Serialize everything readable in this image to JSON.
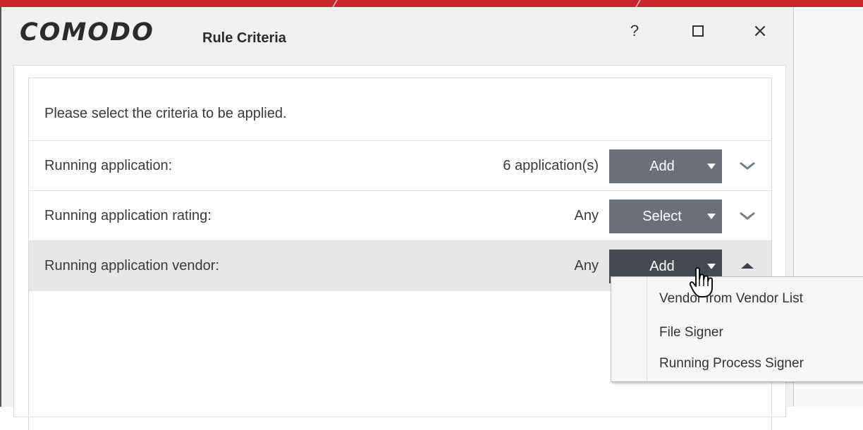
{
  "window": {
    "logo": "COMODO",
    "title": "Rule Criteria",
    "help_label": "?",
    "close_label": "×"
  },
  "instruction": "Please select the criteria to be applied.",
  "rows": [
    {
      "label": "Running application:",
      "value": "6 application(s)",
      "button": "Add",
      "expanded": false
    },
    {
      "label": "Running application rating:",
      "value": "Any",
      "button": "Select",
      "expanded": false
    },
    {
      "label": "Running application vendor:",
      "value": "Any",
      "button": "Add",
      "expanded": true
    }
  ],
  "dropdown_menu": {
    "items": [
      "Vendor from Vendor List",
      "File Signer",
      "Running Process Signer"
    ]
  },
  "colors": {
    "accent_red": "#c8282b",
    "button_gray": "#6c7178",
    "button_dark": "#464a50",
    "selected_row": "#e7e7e7"
  },
  "icons": {
    "chevron_down": "chevron-down-icon",
    "chevron_up": "chevron-up-icon",
    "dropdown_arrow": "caret-down-icon",
    "cursor": "hand-pointer-icon"
  }
}
